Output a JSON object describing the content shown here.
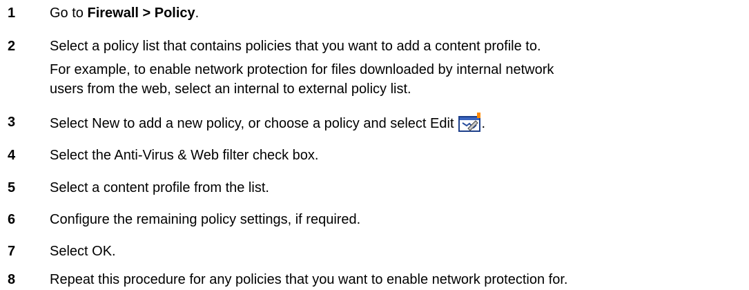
{
  "steps": [
    {
      "num": "1",
      "text_before": "Go to ",
      "bold": "Firewall > Policy",
      "text_after": "."
    },
    {
      "num": "2",
      "text": "Select a policy list that contains policies that you want to add a content profile to.",
      "para2_line1": "For example, to enable network protection for files downloaded by internal network",
      "para2_line2": "users from the web, select an internal to external policy list."
    },
    {
      "num": "3",
      "text": "Select New to add a new policy, or choose a policy and select Edit",
      "after_icon": ".",
      "icon": "edit-icon"
    },
    {
      "num": "4",
      "text": "Select the Anti-Virus & Web filter check box."
    },
    {
      "num": "5",
      "text": "Select a content profile from the list."
    },
    {
      "num": "6",
      "text": "Configure the remaining policy settings, if required."
    },
    {
      "num": "7",
      "text": "Select OK."
    },
    {
      "num": "8",
      "text": "Repeat this procedure for any policies that you want to enable network protection for."
    }
  ]
}
